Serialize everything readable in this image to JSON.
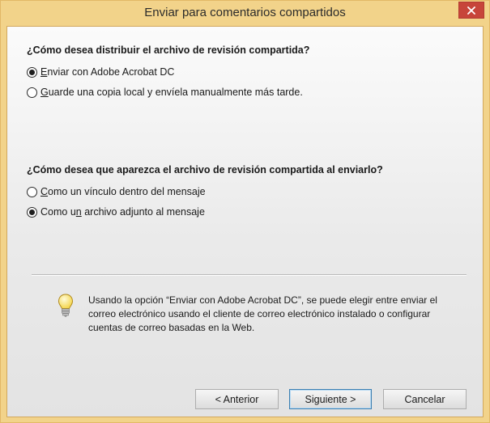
{
  "window": {
    "title": "Enviar para comentarios compartidos"
  },
  "section1": {
    "question": "¿Cómo desea distribuir el archivo de revisión compartida?",
    "options": [
      {
        "pre": "",
        "u": "E",
        "post": "nviar con Adobe Acrobat DC",
        "selected": true
      },
      {
        "pre": "",
        "u": "G",
        "post": "uarde una copia local y envíela manualmente más tarde.",
        "selected": false
      }
    ]
  },
  "section2": {
    "question": "¿Cómo desea que aparezca el archivo de revisión compartida al enviarlo?",
    "options": [
      {
        "pre": "",
        "u": "C",
        "post": "omo un vínculo dentro del mensaje",
        "selected": false
      },
      {
        "pre": "Como u",
        "u": "n",
        "post": " archivo adjunto al mensaje",
        "selected": true
      }
    ]
  },
  "info": {
    "icon": "lightbulb-icon",
    "text": "Usando la opción “Enviar con Adobe Acrobat DC”, se puede elegir entre enviar el correo electrónico usando el cliente de correo electrónico instalado o configurar cuentas de correo basadas en la Web."
  },
  "buttons": {
    "back": "< Anterior",
    "next": "Siguiente >",
    "cancel": "Cancelar"
  },
  "colors": {
    "title_bar": "#f2d38a",
    "close_button": "#c7453a"
  }
}
